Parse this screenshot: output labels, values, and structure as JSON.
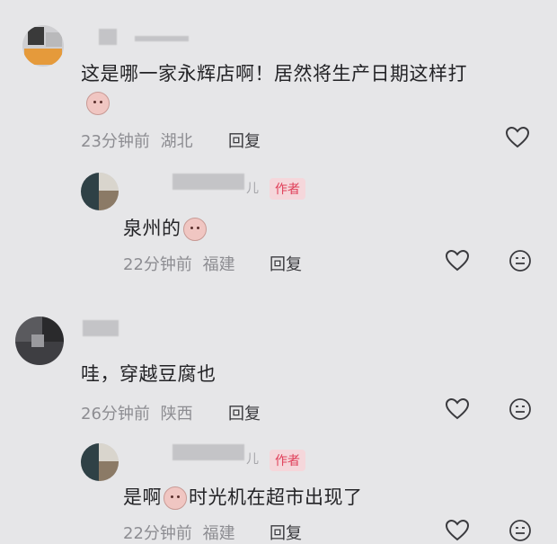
{
  "comments": [
    {
      "text": "这是哪一家永辉店啊！居然将生产日期这样打",
      "time": "23分钟前",
      "location": "湖北",
      "reply": "回复"
    },
    {
      "name_tail": "儿",
      "author_tag": "作者",
      "text": "泉州的",
      "time": "22分钟前",
      "location": "福建",
      "reply": "回复"
    },
    {
      "text": "哇，穿越豆腐也",
      "time": "26分钟前",
      "location": "陕西",
      "reply": "回复"
    },
    {
      "name_tail": "儿",
      "author_tag": "作者",
      "text_before": "是啊",
      "text_after": "时光机在超市出现了",
      "time": "22分钟前",
      "location": "福建",
      "reply": "回复"
    }
  ],
  "icons": {
    "like": "heart-icon",
    "dislike": "neutral-face-icon",
    "emoji": "laughing-face-emoji-icon"
  }
}
